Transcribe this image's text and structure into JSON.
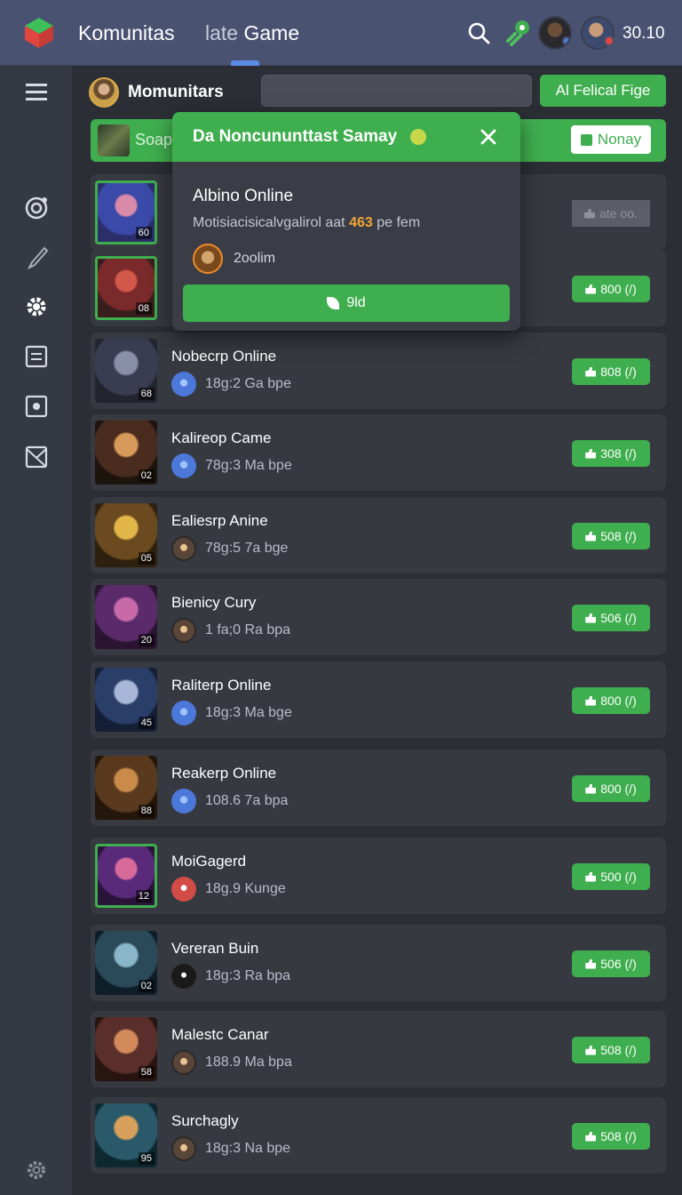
{
  "header": {
    "app_title": "Komunitas",
    "tab_prefix": "late",
    "tab_label": "Game",
    "clock": "30.10",
    "icons": [
      "app-logo-icon",
      "search-icon",
      "link-icon",
      "avatar",
      "avatar"
    ]
  },
  "sidebar": {
    "icons": [
      "menu-icon",
      "radar-icon",
      "brush-icon",
      "gear-icon",
      "document-icon",
      "puzzle-icon",
      "mail-icon",
      "settings-icon"
    ]
  },
  "community": {
    "name": "Momunitars",
    "add_button": "Al Felical Fige"
  },
  "strip": {
    "text": "Soap",
    "button": "Nonay"
  },
  "popup": {
    "title": "Da Noncununttast Samay",
    "game": "Albino Online",
    "desc_pre": "Motisiacisicalvgalirol aat",
    "desc_num": "463",
    "desc_post": "pe fem",
    "user": "2oolim",
    "button": "9ld"
  },
  "games": [
    {
      "title": "",
      "sub": "",
      "level": "60",
      "button": "ate oo.",
      "badge": "none"
    },
    {
      "title": "",
      "sub": "",
      "level": "08",
      "button": "800 (/)",
      "badge": "none"
    },
    {
      "title": "Nobecrp Online",
      "sub": "18g:2 Ga bpe",
      "level": "68",
      "button": "808 (/)",
      "badge": "blue"
    },
    {
      "title": "Kalireop Came",
      "sub": "78g:3 Ma bpe",
      "level": "02",
      "button": "308 (/)",
      "badge": "blue"
    },
    {
      "title": "Ealiesrp Anine",
      "sub": "78g:5 7a bge",
      "level": "05",
      "button": "508 (/)",
      "badge": "gold"
    },
    {
      "title": "Bienicy Cury",
      "sub": "1 fa;0 Ra bpa",
      "level": "20",
      "button": "506 (/)",
      "badge": "gold"
    },
    {
      "title": "Raliterp Online",
      "sub": "18g:3 Ma bge",
      "level": "45",
      "button": "800 (/)",
      "badge": "blue"
    },
    {
      "title": "Reakerp Online",
      "sub": "108.6 7a bpa",
      "level": "88",
      "button": "800 (/)",
      "badge": "blue"
    },
    {
      "title": "MoiGagerd",
      "sub": "18g.9 Kunge",
      "level": "12",
      "button": "500 (/)",
      "badge": "red"
    },
    {
      "title": "Vereran Buin",
      "sub": "18g:3 Ra bpa",
      "level": "02",
      "button": "506 (/)",
      "badge": "dark"
    },
    {
      "title": "Malestc Canar",
      "sub": "188.9 Ma bpa",
      "level": "58",
      "button": "508 (/)",
      "badge": "gold"
    },
    {
      "title": "Surchagly",
      "sub": "18g:3 Na bpe",
      "level": "95",
      "button": "508 (/)",
      "badge": "gold"
    }
  ]
}
